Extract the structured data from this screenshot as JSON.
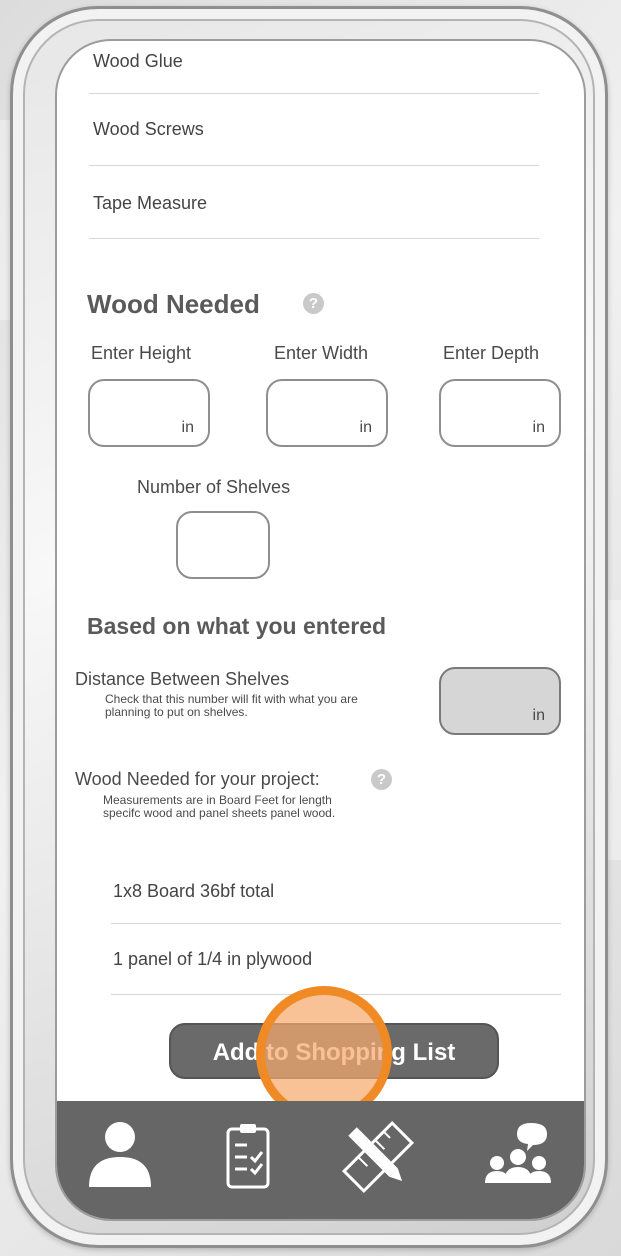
{
  "tools_list": {
    "items": [
      "Wood Glue",
      "Wood Screws",
      "Tape Measure"
    ]
  },
  "wood_needed": {
    "title": "Wood Needed",
    "help_icon": "question-circle-icon",
    "height_label": "Enter Height",
    "width_label": "Enter Width",
    "depth_label": "Enter Depth",
    "shelves_label": "Number of Shelves",
    "unit": "in",
    "height_value": "",
    "width_value": "",
    "depth_value": "",
    "shelves_value": ""
  },
  "results": {
    "title": "Based on what you entered",
    "distance_label": "Distance Between Shelves",
    "distance_note": "Check that this number will fit with what you are planning to put on shelves.",
    "distance_unit": "in",
    "distance_value": "",
    "wood_label": "Wood Needed for your project:",
    "wood_help_icon": "question-circle-icon",
    "wood_note": "Measurements are in Board Feet for length specifc wood and panel sheets panel wood.",
    "items": [
      "1x8 Board 36bf total",
      "1 panel of 1/4 in plywood"
    ]
  },
  "action": {
    "add_to_list_label": "Add to Shopping List"
  },
  "bottom_nav": {
    "items": [
      {
        "name": "profile",
        "icon": "person-icon"
      },
      {
        "name": "checklist",
        "icon": "clipboard-checklist-icon"
      },
      {
        "name": "measure",
        "icon": "pencil-ruler-icon"
      },
      {
        "name": "community",
        "icon": "group-chat-icon"
      }
    ]
  },
  "colors": {
    "accent_highlight": "#f08a24",
    "nav_background": "#666666",
    "button_background": "#6a6a6a"
  }
}
